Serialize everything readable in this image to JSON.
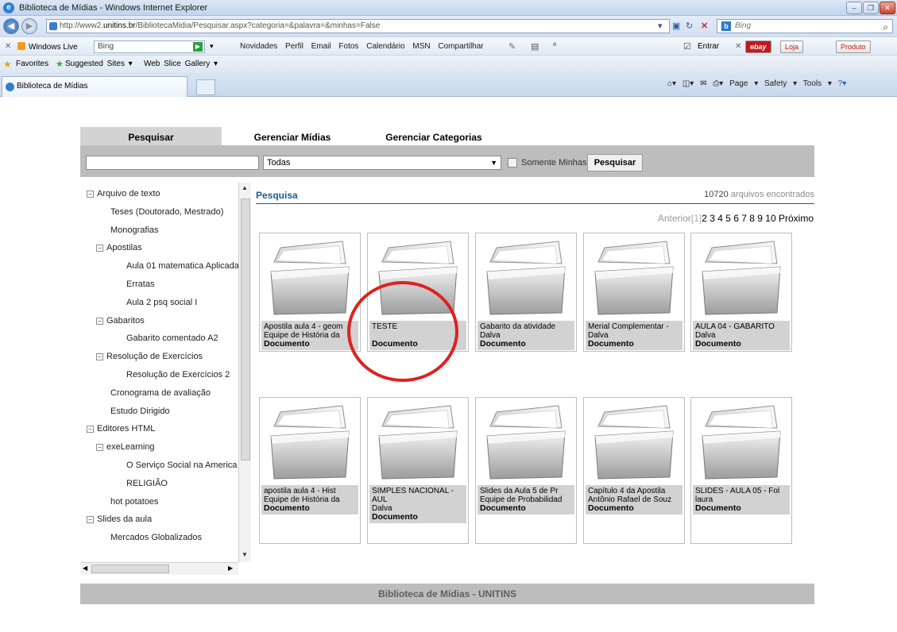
{
  "window": {
    "title": "Biblioteca de Mídias - Windows Internet Explorer"
  },
  "address": {
    "prefix": "http://www2.",
    "domain": "unitins.br",
    "path": "/BibliotecaMidia/Pesquisar.aspx?categoria=&palavra=&minhas=False",
    "search_placeholder": "Bing"
  },
  "livebar": {
    "brand": "Windows Live",
    "search_value": "Bing",
    "links": [
      "Novidades",
      "Perfil",
      "Email",
      "Fotos",
      "Calendário",
      "MSN",
      "Compartilhar"
    ],
    "signin": "Entrar",
    "ebay": "ebay",
    "loja": "Loja",
    "produto": "Produto"
  },
  "favbar": {
    "favorites": "Favorites",
    "suggested": "Suggested Sites ▾",
    "gallery": "Web Slice Gallery ▾"
  },
  "tab": {
    "label": "Biblioteca de Mídias"
  },
  "commandbar": {
    "page": "Page ▾",
    "safety": "Safety ▾",
    "tools": "Tools ▾"
  },
  "maintabs": [
    "Pesquisar",
    "Gerenciar Mídias",
    "Gerenciar Categorias"
  ],
  "search": {
    "category": "Todas",
    "only_mine": "Somente Minhas",
    "button": "Pesquisar"
  },
  "tree": [
    {
      "label": "Arquivo de texto",
      "level": 0,
      "toggle": true
    },
    {
      "label": "Teses (Doutorado, Mestrado)",
      "level": 1,
      "toggle": false
    },
    {
      "label": "Monografias",
      "level": 1,
      "toggle": false
    },
    {
      "label": "Apostilas",
      "level": 1,
      "toggle": true
    },
    {
      "label": "Aula 01 matematica Aplicada",
      "level": 2,
      "toggle": false
    },
    {
      "label": "Erratas",
      "level": 2,
      "toggle": false
    },
    {
      "label": "Aula 2 psq social I",
      "level": 2,
      "toggle": false
    },
    {
      "label": "Gabaritos",
      "level": 1,
      "toggle": true
    },
    {
      "label": "Gabarito comentado A2",
      "level": 2,
      "toggle": false
    },
    {
      "label": "Resolução de Exercícios",
      "level": 1,
      "toggle": true
    },
    {
      "label": "Resolução de Exercícios 2",
      "level": 2,
      "toggle": false
    },
    {
      "label": "Cronograma de avaliação",
      "level": 1,
      "toggle": false
    },
    {
      "label": "Estudo Dirigido",
      "level": 1,
      "toggle": false
    },
    {
      "label": "Editores HTML",
      "level": 0,
      "toggle": true
    },
    {
      "label": "exeLearning",
      "level": 1,
      "toggle": true
    },
    {
      "label": "O Serviço Social na America L",
      "level": 2,
      "toggle": false
    },
    {
      "label": "RELIGIÃO",
      "level": 2,
      "toggle": false
    },
    {
      "label": "hot potatoes",
      "level": 1,
      "toggle": false
    },
    {
      "label": "Slides da aula",
      "level": 0,
      "toggle": true
    },
    {
      "label": "Mercados Globalizados",
      "level": 1,
      "toggle": false
    }
  ],
  "results": {
    "title": "Pesquisa",
    "count": "10720",
    "count_suffix": " arquivos encontrados",
    "pager_prev": "Anterior",
    "pager_current": "[1]",
    "pager_pages": "2 3 4 5 6 7 8 9 10",
    "pager_next": "Próximo"
  },
  "cards": [
    {
      "lines": [
        "Apostila aula 4 - geom",
        "Equipe de História da"
      ],
      "type": "Documento"
    },
    {
      "lines": [
        "TESTE",
        ""
      ],
      "type": "Documento"
    },
    {
      "lines": [
        "Gabarito da atividade",
        "Dalva"
      ],
      "type": "Documento"
    },
    {
      "lines": [
        "Merial Complementar -",
        "Dalva"
      ],
      "type": "Documento"
    },
    {
      "lines": [
        "AULA 04 - GABARITO",
        "Dalva"
      ],
      "type": "Documento"
    },
    {
      "lines": [
        "apostila aula 4 - Hist",
        "Equipe de História da"
      ],
      "type": "Documento"
    },
    {
      "lines": [
        "SIMPLES NACIONAL -",
        "AUL",
        "Dalva"
      ],
      "type": "Documento"
    },
    {
      "lines": [
        "Slides da Aula 5 de Pr",
        "Equipe de Probabilidad"
      ],
      "type": "Documento"
    },
    {
      "lines": [
        "Capítulo 4 da Apostila",
        "Antônio Rafael de Souz"
      ],
      "type": "Documento"
    },
    {
      "lines": [
        "SLIDES - AULA 05 - Fol",
        "laura"
      ],
      "type": "Documento"
    }
  ],
  "footer": "Biblioteca de Mídias - UNITINS",
  "colors": {
    "highlight_ring": "#e02020",
    "result_title": "#1d5a8c",
    "panel_gray": "#bdbdbd"
  }
}
